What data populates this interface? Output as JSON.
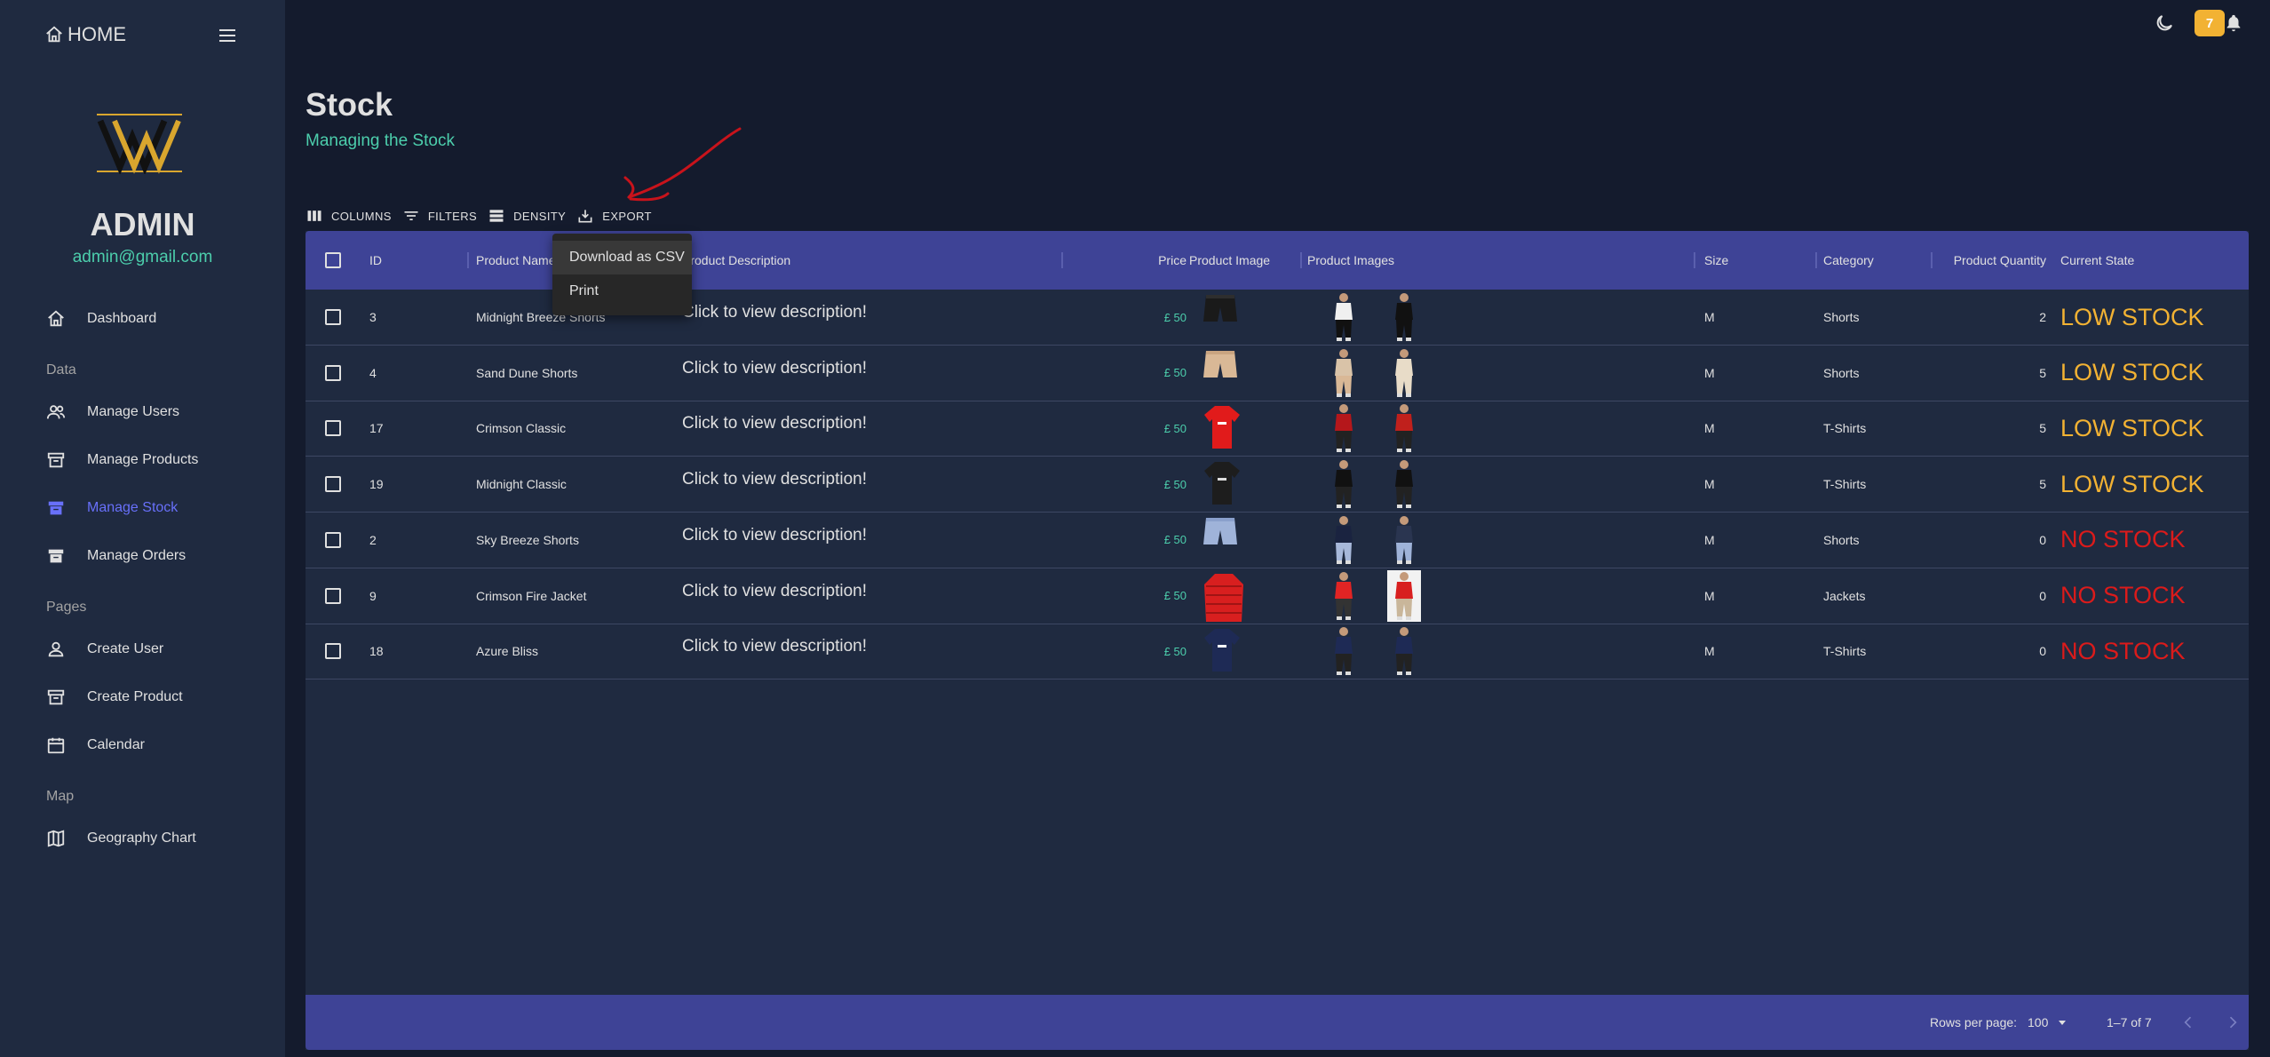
{
  "sidebar": {
    "home_label": "HOME",
    "admin_name": "ADMIN",
    "admin_email": "admin@gmail.com",
    "sections": {
      "data": "Data",
      "pages": "Pages",
      "map": "Map"
    },
    "items": {
      "dashboard": "Dashboard",
      "manage_users": "Manage Users",
      "manage_products": "Manage Products",
      "manage_stock": "Manage Stock",
      "manage_orders": "Manage Orders",
      "create_user": "Create User",
      "create_product": "Create Product",
      "calendar": "Calendar",
      "geography_chart": "Geography Chart"
    },
    "active_item": "manage_stock",
    "active_color": "#6870fa"
  },
  "topbar": {
    "notification_count": "7",
    "badge_color": "#f2b233"
  },
  "header": {
    "title": "Stock",
    "subtitle": "Managing the Stock",
    "subtitle_color": "#4cceac"
  },
  "toolbar": {
    "columns": "COLUMNS",
    "filters": "FILTERS",
    "density": "DENSITY",
    "export": "EXPORT"
  },
  "export_menu": {
    "csv": "Download as CSV",
    "print": "Print"
  },
  "table": {
    "header_color": "#3e4396",
    "columns": {
      "id": "ID",
      "name": "Product Name",
      "description": "Product Description",
      "price": "Price",
      "image": "Product Image",
      "images": "Product Images",
      "size": "Size",
      "category": "Category",
      "quantity": "Product Quantity",
      "state": "Current State"
    },
    "rows": [
      {
        "id": "3",
        "name": "Midnight Breeze Shorts",
        "description": "Click to view description!",
        "price": "£ 50",
        "size": "M",
        "category": "Shorts",
        "quantity": "2",
        "state": "LOW STOCK",
        "state_kind": "low"
      },
      {
        "id": "4",
        "name": "Sand Dune Shorts",
        "description": "Click to view description!",
        "price": "£ 50",
        "size": "M",
        "category": "Shorts",
        "quantity": "5",
        "state": "LOW STOCK",
        "state_kind": "low"
      },
      {
        "id": "17",
        "name": "Crimson Classic",
        "description": "Click to view description!",
        "price": "£ 50",
        "size": "M",
        "category": "T-Shirts",
        "quantity": "5",
        "state": "LOW STOCK",
        "state_kind": "low"
      },
      {
        "id": "19",
        "name": "Midnight Classic",
        "description": "Click to view description!",
        "price": "£ 50",
        "size": "M",
        "category": "T-Shirts",
        "quantity": "5",
        "state": "LOW STOCK",
        "state_kind": "low"
      },
      {
        "id": "2",
        "name": "Sky Breeze Shorts",
        "description": "Click to view description!",
        "price": "£ 50",
        "size": "M",
        "category": "Shorts",
        "quantity": "0",
        "state": "NO STOCK",
        "state_kind": "none"
      },
      {
        "id": "9",
        "name": "Crimson Fire Jacket",
        "description": "Click to view description!",
        "price": "£ 50",
        "size": "M",
        "category": "Jackets",
        "quantity": "0",
        "state": "NO STOCK",
        "state_kind": "none"
      },
      {
        "id": "18",
        "name": "Azure Bliss",
        "description": "Click to view description!",
        "price": "£ 50",
        "size": "M",
        "category": "T-Shirts",
        "quantity": "0",
        "state": "NO STOCK",
        "state_kind": "none"
      }
    ],
    "status_colors": {
      "low": "#f2b233",
      "none": "#db1b1b"
    }
  },
  "footer": {
    "rows_per_page_label": "Rows per page:",
    "rows_per_page_value": "100",
    "range": "1–7 of 7"
  }
}
